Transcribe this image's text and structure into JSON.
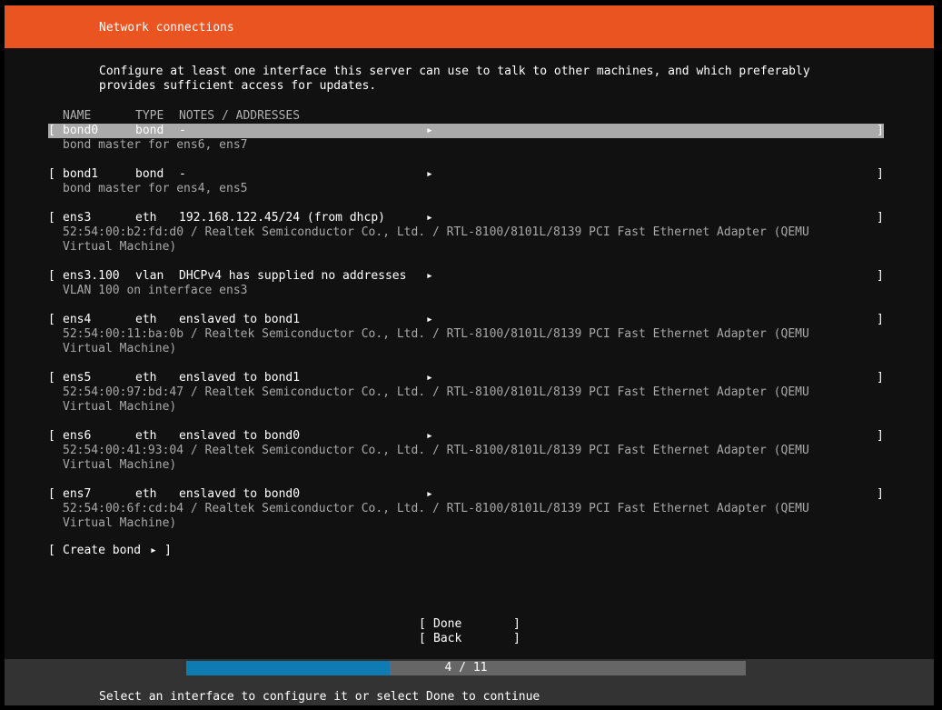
{
  "header": {
    "title": "Network connections"
  },
  "intro": {
    "line1": "Configure at least one interface this server can use to talk to other machines, and which preferably",
    "line2": "provides sufficient access for updates."
  },
  "columns": {
    "name": "NAME",
    "type": "TYPE",
    "notes": "NOTES / ADDRESSES"
  },
  "glyphs": {
    "open": "[",
    "close": "]",
    "arrow": "▸"
  },
  "interfaces": [
    {
      "name": "bond0",
      "type": "bond",
      "notes": "-",
      "sub": [
        "bond master for ens6, ens7"
      ]
    },
    {
      "name": "bond1",
      "type": "bond",
      "notes": "-",
      "sub": [
        "bond master for ens4, ens5"
      ]
    },
    {
      "name": "ens3",
      "type": "eth",
      "notes": "192.168.122.45/24 (from dhcp)",
      "sub": [
        "52:54:00:b2:fd:d0 / Realtek Semiconductor Co., Ltd. / RTL-8100/8101L/8139 PCI Fast Ethernet Adapter (QEMU",
        "Virtual Machine)"
      ]
    },
    {
      "name": "ens3.100",
      "type": "vlan",
      "notes": "DHCPv4 has supplied no addresses",
      "sub": [
        "VLAN 100 on interface ens3"
      ]
    },
    {
      "name": "ens4",
      "type": "eth",
      "notes": "enslaved to bond1",
      "sub": [
        "52:54:00:11:ba:0b / Realtek Semiconductor Co., Ltd. / RTL-8100/8101L/8139 PCI Fast Ethernet Adapter (QEMU",
        "Virtual Machine)"
      ]
    },
    {
      "name": "ens5",
      "type": "eth",
      "notes": "enslaved to bond1",
      "sub": [
        "52:54:00:97:bd:47 / Realtek Semiconductor Co., Ltd. / RTL-8100/8101L/8139 PCI Fast Ethernet Adapter (QEMU",
        "Virtual Machine)"
      ]
    },
    {
      "name": "ens6",
      "type": "eth",
      "notes": "enslaved to bond0",
      "sub": [
        "52:54:00:41:93:04 / Realtek Semiconductor Co., Ltd. / RTL-8100/8101L/8139 PCI Fast Ethernet Adapter (QEMU",
        "Virtual Machine)"
      ]
    },
    {
      "name": "ens7",
      "type": "eth",
      "notes": "enslaved to bond0",
      "sub": [
        "52:54:00:6f:cd:b4 / Realtek Semiconductor Co., Ltd. / RTL-8100/8101L/8139 PCI Fast Ethernet Adapter (QEMU",
        "Virtual Machine)"
      ]
    }
  ],
  "create_bond": {
    "label": "Create bond"
  },
  "buttons": {
    "done": "Done",
    "back": "Back"
  },
  "progress": {
    "current": 4,
    "total": 11,
    "text": "4 / 11"
  },
  "footer": {
    "message": "Select an interface to configure it or select Done to continue"
  },
  "colors": {
    "header": "#e95420",
    "progress_fill": "#0e7bb2",
    "selected_row": "#aaaaaa"
  }
}
